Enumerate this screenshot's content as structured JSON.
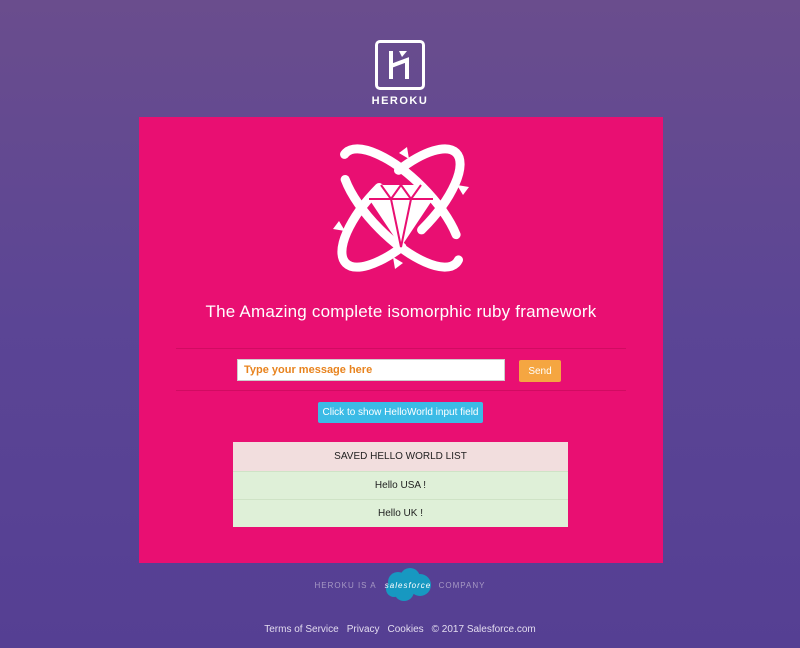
{
  "brand": {
    "logo_text": "HEROKU"
  },
  "hero": {
    "headline": "The Amazing complete isomorphic ruby framework"
  },
  "form": {
    "message_placeholder": "Type your message here",
    "send_label": "Send",
    "show_field_label": "Click to show HelloWorld input field"
  },
  "saved_list": {
    "header": "SAVED HELLO WORLD LIST",
    "items": [
      "Hello USA !",
      "Hello UK !"
    ]
  },
  "company": {
    "prefix": "HEROKU IS A",
    "badge": "salesforce",
    "suffix": "COMPANY"
  },
  "footer": {
    "links": [
      "Terms of Service",
      "Privacy",
      "Cookies"
    ],
    "copyright": "© 2017 Salesforce.com"
  },
  "colors": {
    "background": "#5b4595",
    "card": "#e90f72",
    "send_button": "#f5a641",
    "show_button": "#3bbbe6",
    "list_header": "#f2dede",
    "list_row": "#dff0d8"
  },
  "icons": [
    "heroku-logo-icon",
    "ruby-atom-icon",
    "salesforce-cloud-icon"
  ]
}
